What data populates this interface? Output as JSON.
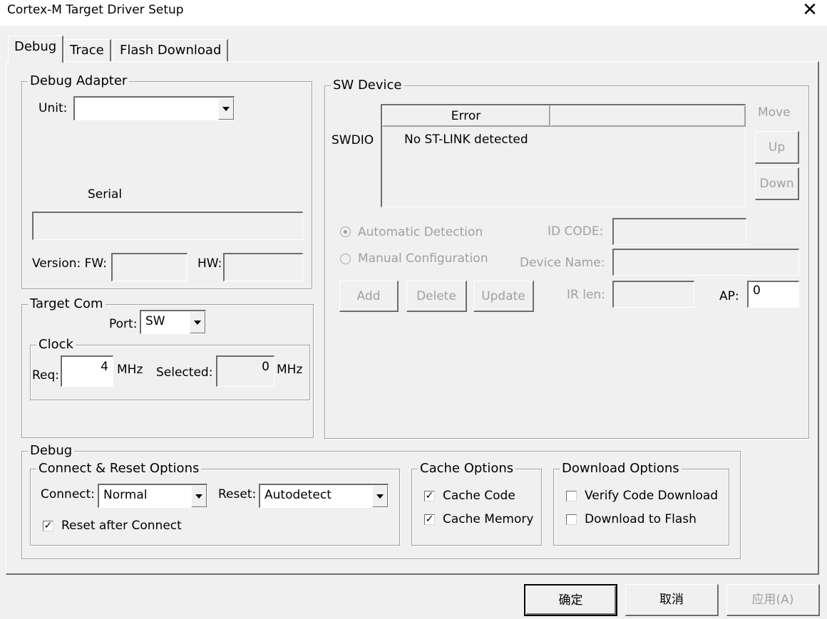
{
  "window": {
    "title": "Cortex-M Target Driver Setup",
    "close_glyph": "✕"
  },
  "tabs": [
    "Debug",
    "Trace",
    "Flash Download"
  ],
  "debug_adapter": {
    "legend": "Debug Adapter",
    "unit_label": "Unit:",
    "unit_value": "",
    "serial_label": "Serial",
    "serial_value": "",
    "version_label": "Version: FW:",
    "fw_value": "",
    "hw_label": "HW:",
    "hw_value": ""
  },
  "target_com": {
    "legend": "Target Com",
    "port_label": "Port:",
    "port_value": "SW",
    "clock_legend": "Clock",
    "req_label": "Req:",
    "req_value": "4",
    "req_unit": "MHz",
    "selected_label": "Selected:",
    "selected_value": "0",
    "selected_unit": "MHz"
  },
  "sw_device": {
    "legend": "SW Device",
    "move_label": "Move",
    "up_button": "Up",
    "down_button": "Down",
    "swdio_label": "SWDIO",
    "columns": [
      "Error",
      ""
    ],
    "rows": [
      [
        "No ST-LINK detected",
        ""
      ]
    ],
    "auto_detect_label": "Automatic Detection",
    "manual_config_label": "Manual Configuration",
    "idcode_label": "ID CODE:",
    "idcode_value": "",
    "device_name_label": "Device Name:",
    "device_name_value": "",
    "add_button": "Add",
    "delete_button": "Delete",
    "update_button": "Update",
    "irlen_label": "IR len:",
    "irlen_value": "",
    "ap_label": "AP:",
    "ap_value": "0"
  },
  "debug_section": {
    "legend": "Debug",
    "connect_reset": {
      "legend": "Connect & Reset Options",
      "connect_label": "Connect:",
      "connect_value": "Normal",
      "reset_label": "Reset:",
      "reset_value": "Autodetect",
      "reset_after_connect_label": "Reset after Connect",
      "reset_after_connect_checked": true
    },
    "cache_options": {
      "legend": "Cache Options",
      "cache_code_label": "Cache Code",
      "cache_code_checked": true,
      "cache_memory_label": "Cache Memory",
      "cache_memory_checked": true
    },
    "download_options": {
      "legend": "Download Options",
      "verify_label": "Verify Code Download",
      "verify_checked": false,
      "flash_label": "Download to Flash",
      "flash_checked": false
    }
  },
  "footer": {
    "ok": "确定",
    "cancel": "取消",
    "apply": "应用(A)"
  },
  "check_glyph": "✓"
}
